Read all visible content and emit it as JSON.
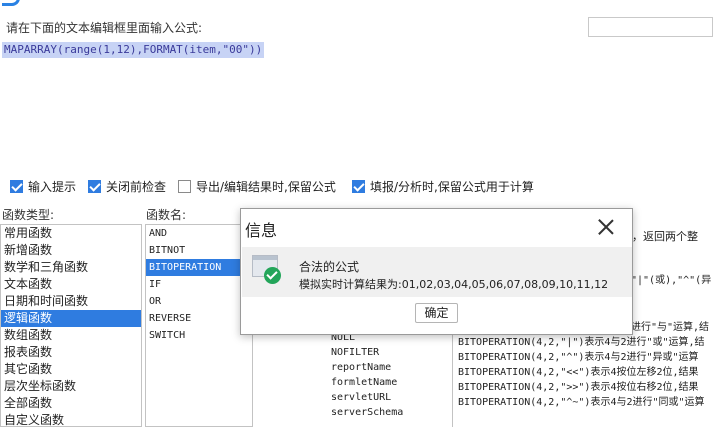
{
  "prompt_label": "请在下面的文本编辑框里面输入公式:",
  "formula": "MAPARRAY(range(1,12),FORMAT(item,\"00\"))",
  "options": [
    {
      "label": "输入提示",
      "checked": true
    },
    {
      "label": "关闭前检查",
      "checked": true
    },
    {
      "label": "导出/编辑结果时,保留公式",
      "checked": false
    },
    {
      "label": "填报/分析时,保留公式用于计算",
      "checked": true
    }
  ],
  "function_types": {
    "label": "函数类型:",
    "items": [
      "常用函数",
      "新增函数",
      "数学和三角函数",
      "文本函数",
      "日期和时间函数",
      "逻辑函数",
      "数组函数",
      "报表函数",
      "其它函数",
      "层次坐标函数",
      "全部函数",
      "自定义函数"
    ],
    "selected_index": 5
  },
  "function_names": {
    "label": "函数名:",
    "items": [
      "AND",
      "BITNOT",
      "BITOPERATION",
      "IF",
      "OR",
      "REVERSE",
      "SWITCH"
    ],
    "selected_index": 2
  },
  "params": {
    "items": [
      "NULL",
      "NOFILTER",
      "reportName",
      "formletName",
      "servletURL",
      "serverSchema"
    ]
  },
  "description": {
    "lines_top": [
      "算，返回两个整",
      "\"|\"(或),\"^\"(异"
    ],
    "lines": [
      "进行\"与\"运算,结",
      "BITOPERATION(4,2,\"|\")表示4与2进行\"或\"运算,结",
      "BITOPERATION(4,2,\"^\")表示4与2进行\"异或\"运算",
      "BITOPERATION(4,2,\"<<\")表示4按位左移2位,结果",
      "BITOPERATION(4,2,\">>\")表示4按位右移2位,结果",
      "BITOPERATION(4,2,\"^~\")表示4与2进行\"同或\"运算"
    ]
  },
  "dialog": {
    "title": "信息",
    "message": "合法的公式",
    "result": "模拟实时计算结果为:01,02,03,04,05,06,07,08,09,10,11,12",
    "ok_label": "确定"
  },
  "colors": {
    "accent": "#2f7ce0",
    "selection_highlight": "#c7d3f5",
    "success_icon": "#23a55a"
  }
}
